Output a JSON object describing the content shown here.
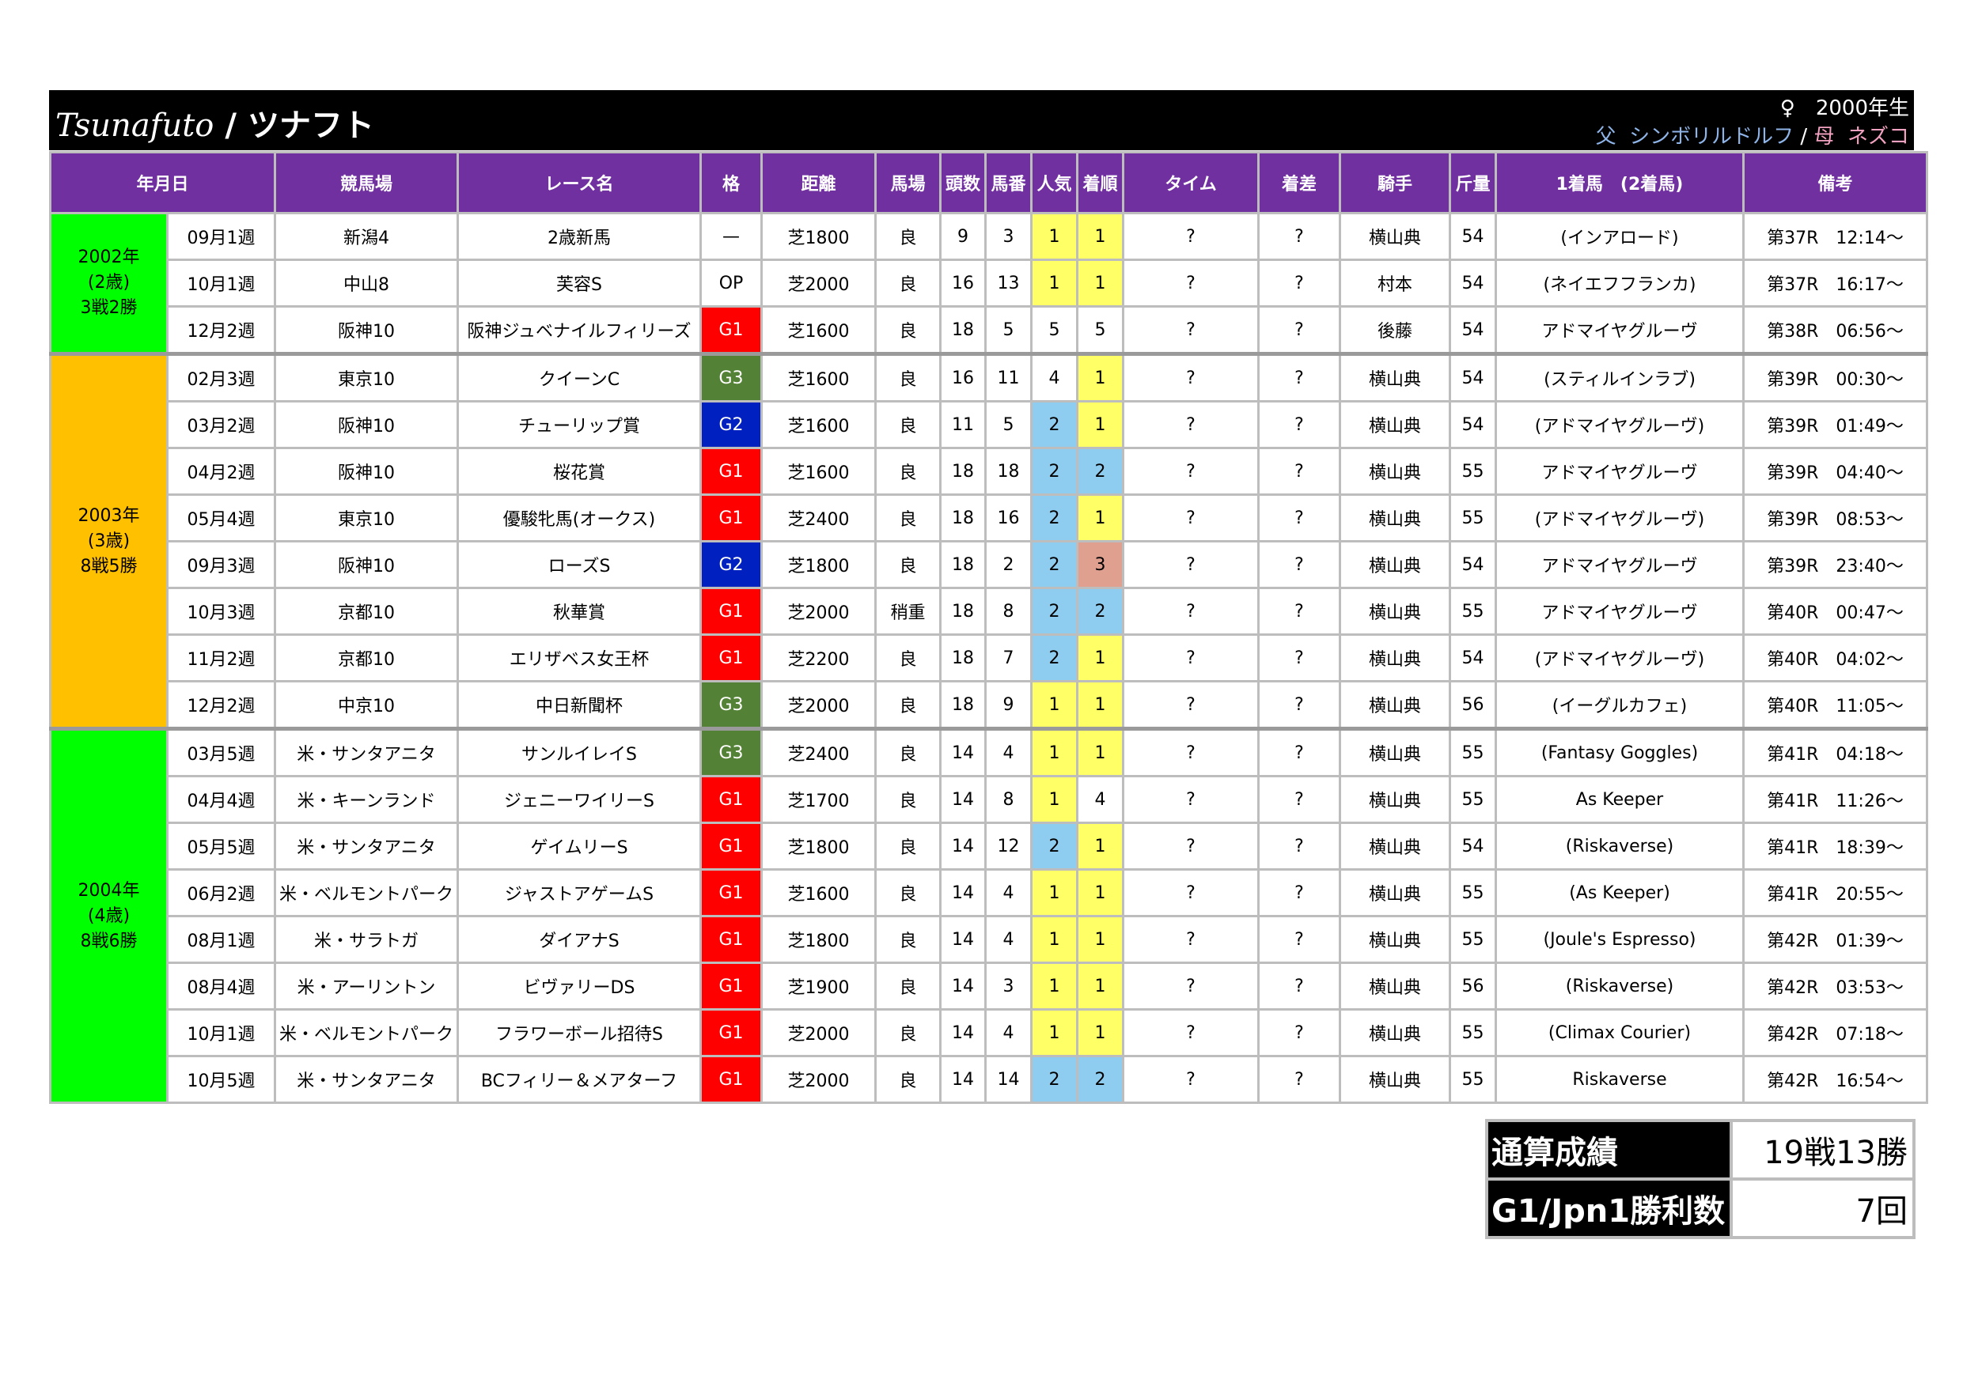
{
  "header": {
    "name_en": "Tsunafuto",
    "separator": "/",
    "name_jp": "ツナフト",
    "sex_born": "♀　2000年生",
    "sire_label": "父",
    "sire": "シンボリルドルフ",
    "pedigree_sep": "/",
    "dam_label": "母",
    "dam": "ネズコ"
  },
  "columns": [
    "年月日",
    "競馬場",
    "レース名",
    "格",
    "距離",
    "馬場",
    "頭数",
    "馬番",
    "人気",
    "着順",
    "タイム",
    "着差",
    "騎手",
    "斤量",
    "1着馬　(2着馬)",
    "備考"
  ],
  "colors": {
    "header_bg": "#000000",
    "column_header_bg": "#7030a0",
    "age2_bg": "#00ff00",
    "age3_bg": "#ffc000",
    "age4_bg": "#00ff00",
    "G1": "#ff0000",
    "G2": "#0020c0",
    "G3": "#538135",
    "rank_1": "#ffff66",
    "rank_2": "#8ecdf0",
    "rank_3": "#e0a090"
  },
  "years": [
    {
      "label": [
        "2002年",
        "(2歳)",
        "3戦2勝"
      ],
      "color": "#00ff00",
      "races": [
        {
          "date": "09月1週",
          "track": "新潟4",
          "race": "2歳新馬",
          "grade": "—",
          "dist": "芝1800",
          "cond": "良",
          "field": "9",
          "num": "3",
          "pop": "1",
          "finish": "1",
          "time": "?",
          "margin": "?",
          "jockey": "横山典",
          "weight": "54",
          "winner": "(インアロード)",
          "note": "第37R　12:14〜"
        },
        {
          "date": "10月1週",
          "track": "中山8",
          "race": "芙容S",
          "grade": "OP",
          "dist": "芝2000",
          "cond": "良",
          "field": "16",
          "num": "13",
          "pop": "1",
          "finish": "1",
          "time": "?",
          "margin": "?",
          "jockey": "村本",
          "weight": "54",
          "winner": "(ネイエフフランカ)",
          "note": "第37R　16:17〜"
        },
        {
          "date": "12月2週",
          "track": "阪神10",
          "race": "阪神ジュベナイルフィリーズ",
          "grade": "G1",
          "dist": "芝1600",
          "cond": "良",
          "field": "18",
          "num": "5",
          "pop": "5",
          "finish": "5",
          "time": "?",
          "margin": "?",
          "jockey": "後藤",
          "weight": "54",
          "winner": "アドマイヤグルーヴ",
          "note": "第38R　06:56〜"
        }
      ]
    },
    {
      "label": [
        "2003年",
        "(3歳)",
        "8戦5勝"
      ],
      "color": "#ffc000",
      "races": [
        {
          "date": "02月3週",
          "track": "東京10",
          "race": "クイーンC",
          "grade": "G3",
          "dist": "芝1600",
          "cond": "良",
          "field": "16",
          "num": "11",
          "pop": "4",
          "finish": "1",
          "time": "?",
          "margin": "?",
          "jockey": "横山典",
          "weight": "54",
          "winner": "(スティルインラブ)",
          "note": "第39R　00:30〜"
        },
        {
          "date": "03月2週",
          "track": "阪神10",
          "race": "チューリップ賞",
          "grade": "G2",
          "dist": "芝1600",
          "cond": "良",
          "field": "11",
          "num": "5",
          "pop": "2",
          "finish": "1",
          "time": "?",
          "margin": "?",
          "jockey": "横山典",
          "weight": "54",
          "winner": "(アドマイヤグルーヴ)",
          "note": "第39R　01:49〜"
        },
        {
          "date": "04月2週",
          "track": "阪神10",
          "race": "桜花賞",
          "grade": "G1",
          "dist": "芝1600",
          "cond": "良",
          "field": "18",
          "num": "18",
          "pop": "2",
          "finish": "2",
          "time": "?",
          "margin": "?",
          "jockey": "横山典",
          "weight": "55",
          "winner": "アドマイヤグルーヴ",
          "note": "第39R　04:40〜"
        },
        {
          "date": "05月4週",
          "track": "東京10",
          "race": "優駿牝馬(オークス)",
          "grade": "G1",
          "dist": "芝2400",
          "cond": "良",
          "field": "18",
          "num": "16",
          "pop": "2",
          "finish": "1",
          "time": "?",
          "margin": "?",
          "jockey": "横山典",
          "weight": "55",
          "winner": "(アドマイヤグルーヴ)",
          "note": "第39R　08:53〜"
        },
        {
          "date": "09月3週",
          "track": "阪神10",
          "race": "ローズS",
          "grade": "G2",
          "dist": "芝1800",
          "cond": "良",
          "field": "18",
          "num": "2",
          "pop": "2",
          "finish": "3",
          "time": "?",
          "margin": "?",
          "jockey": "横山典",
          "weight": "54",
          "winner": "アドマイヤグルーヴ",
          "note": "第39R　23:40〜"
        },
        {
          "date": "10月3週",
          "track": "京都10",
          "race": "秋華賞",
          "grade": "G1",
          "dist": "芝2000",
          "cond": "稍重",
          "field": "18",
          "num": "8",
          "pop": "2",
          "finish": "2",
          "time": "?",
          "margin": "?",
          "jockey": "横山典",
          "weight": "55",
          "winner": "アドマイヤグルーヴ",
          "note": "第40R　00:47〜"
        },
        {
          "date": "11月2週",
          "track": "京都10",
          "race": "エリザベス女王杯",
          "grade": "G1",
          "dist": "芝2200",
          "cond": "良",
          "field": "18",
          "num": "7",
          "pop": "2",
          "finish": "1",
          "time": "?",
          "margin": "?",
          "jockey": "横山典",
          "weight": "54",
          "winner": "(アドマイヤグルーヴ)",
          "note": "第40R　04:02〜"
        },
        {
          "date": "12月2週",
          "track": "中京10",
          "race": "中日新聞杯",
          "grade": "G3",
          "dist": "芝2000",
          "cond": "良",
          "field": "18",
          "num": "9",
          "pop": "1",
          "finish": "1",
          "time": "?",
          "margin": "?",
          "jockey": "横山典",
          "weight": "56",
          "winner": "(イーグルカフェ)",
          "note": "第40R　11:05〜"
        }
      ]
    },
    {
      "label": [
        "2004年",
        "(4歳)",
        "8戦6勝"
      ],
      "color": "#00ff00",
      "races": [
        {
          "date": "03月5週",
          "track": "米・サンタアニタ",
          "race": "サンルイレイS",
          "grade": "G3",
          "dist": "芝2400",
          "cond": "良",
          "field": "14",
          "num": "4",
          "pop": "1",
          "finish": "1",
          "time": "?",
          "margin": "?",
          "jockey": "横山典",
          "weight": "55",
          "winner": "(Fantasy Goggles)",
          "note": "第41R　04:18〜"
        },
        {
          "date": "04月4週",
          "track": "米・キーンランド",
          "race": "ジェニーワイリーS",
          "grade": "G1",
          "dist": "芝1700",
          "cond": "良",
          "field": "14",
          "num": "8",
          "pop": "1",
          "finish": "4",
          "time": "?",
          "margin": "?",
          "jockey": "横山典",
          "weight": "55",
          "winner": "As Keeper",
          "note": "第41R　11:26〜"
        },
        {
          "date": "05月5週",
          "track": "米・サンタアニタ",
          "race": "ゲイムリーS",
          "grade": "G1",
          "dist": "芝1800",
          "cond": "良",
          "field": "14",
          "num": "12",
          "pop": "2",
          "finish": "1",
          "time": "?",
          "margin": "?",
          "jockey": "横山典",
          "weight": "54",
          "winner": "(Riskaverse)",
          "note": "第41R　18:39〜"
        },
        {
          "date": "06月2週",
          "track": "米・ベルモントパーク",
          "race": "ジャストアゲームS",
          "grade": "G1",
          "dist": "芝1600",
          "cond": "良",
          "field": "14",
          "num": "4",
          "pop": "1",
          "finish": "1",
          "time": "?",
          "margin": "?",
          "jockey": "横山典",
          "weight": "55",
          "winner": "(As Keeper)",
          "note": "第41R　20:55〜"
        },
        {
          "date": "08月1週",
          "track": "米・サラトガ",
          "race": "ダイアナS",
          "grade": "G1",
          "dist": "芝1800",
          "cond": "良",
          "field": "14",
          "num": "4",
          "pop": "1",
          "finish": "1",
          "time": "?",
          "margin": "?",
          "jockey": "横山典",
          "weight": "55",
          "winner": "(Joule's Espresso)",
          "note": "第42R　01:39〜"
        },
        {
          "date": "08月4週",
          "track": "米・アーリントン",
          "race": "ビヴァリーDS",
          "grade": "G1",
          "dist": "芝1900",
          "cond": "良",
          "field": "14",
          "num": "3",
          "pop": "1",
          "finish": "1",
          "time": "?",
          "margin": "?",
          "jockey": "横山典",
          "weight": "56",
          "winner": "(Riskaverse)",
          "note": "第42R　03:53〜"
        },
        {
          "date": "10月1週",
          "track": "米・ベルモントパーク",
          "race": "フラワーボール招待S",
          "grade": "G1",
          "dist": "芝2000",
          "cond": "良",
          "field": "14",
          "num": "4",
          "pop": "1",
          "finish": "1",
          "time": "?",
          "margin": "?",
          "jockey": "横山典",
          "weight": "55",
          "winner": "(Climax Courier)",
          "note": "第42R　07:18〜"
        },
        {
          "date": "10月5週",
          "track": "米・サンタアニタ",
          "race": "BCフィリー＆メアターフ",
          "grade": "G1",
          "dist": "芝2000",
          "cond": "良",
          "field": "14",
          "num": "14",
          "pop": "2",
          "finish": "2",
          "time": "?",
          "margin": "?",
          "jockey": "横山典",
          "weight": "55",
          "winner": "Riskaverse",
          "note": "第42R　16:54〜"
        }
      ]
    }
  ],
  "summary": [
    {
      "label": "通算成績",
      "value": "19戦13勝"
    },
    {
      "label": "G1/Jpn1勝利数",
      "value": "7回"
    }
  ]
}
